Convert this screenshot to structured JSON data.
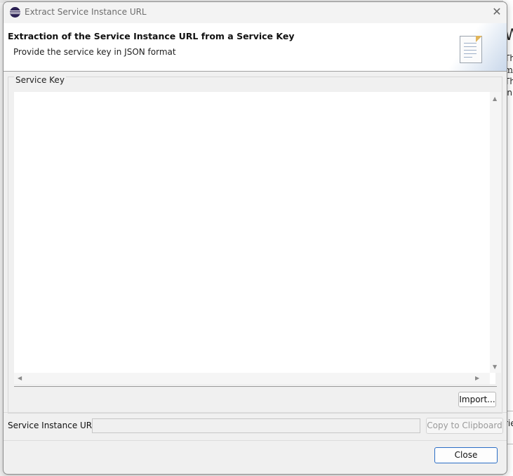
{
  "window": {
    "title": "Extract Service Instance URL",
    "close_glyph": "✕"
  },
  "banner": {
    "title": "Extraction of the Service Instance URL from a Service Key",
    "subtitle": "Provide the service key in JSON format",
    "icon": "document-icon"
  },
  "service_key": {
    "group_label": "Service Key",
    "value": "",
    "scroll_up": "▲",
    "scroll_down": "▼",
    "scroll_left": "◀",
    "scroll_right": "▶",
    "import_label": "Import..."
  },
  "url": {
    "label": "Service Instance URL:",
    "value": "",
    "copy_label": "Copy to Clipboard"
  },
  "footer": {
    "close_label": "Close"
  },
  "background": {
    "heading_fragment": "W",
    "lines": [
      "Th",
      "m",
      "Th",
      "in"
    ],
    "bottom_fragment": "rie"
  },
  "colors": {
    "accent": "#2b6ec6",
    "dialog_bg": "#f0f0f0",
    "banner_bg": "#ffffff"
  }
}
